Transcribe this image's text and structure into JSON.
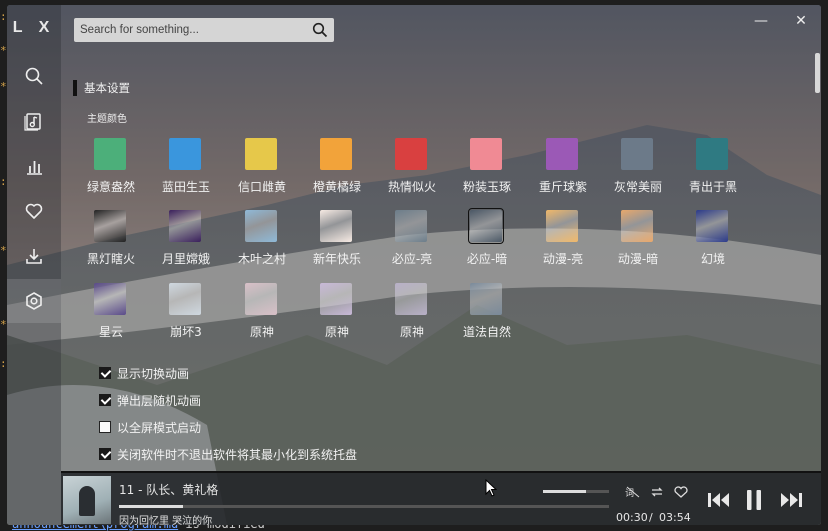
{
  "app": {
    "logo": "L X"
  },
  "search": {
    "placeholder": "Search for something..."
  },
  "window_controls": {
    "minimize": "—",
    "close": "✕"
  },
  "sidebar": {
    "items": [
      {
        "name": "search",
        "icon": "search-icon"
      },
      {
        "name": "songlist",
        "icon": "playlist-icon"
      },
      {
        "name": "leaderboard",
        "icon": "chart-icon"
      },
      {
        "name": "my-list",
        "icon": "heart-icon"
      },
      {
        "name": "download",
        "icon": "download-icon"
      },
      {
        "name": "settings",
        "icon": "settings-icon",
        "active": true
      }
    ]
  },
  "settings": {
    "section_title": "基本设置",
    "theme_label": "主题颜色",
    "themes": [
      {
        "label": "绿意盎然",
        "color": "#4caf7a",
        "type": "color"
      },
      {
        "label": "蓝田生玉",
        "color": "#3a96dd",
        "type": "color"
      },
      {
        "label": "信口雌黄",
        "color": "#e6c84a",
        "type": "color"
      },
      {
        "label": "橙黄橘绿",
        "color": "#f2a33a",
        "type": "color"
      },
      {
        "label": "热情似火",
        "color": "#d94040",
        "type": "color"
      },
      {
        "label": "粉装玉琢",
        "color": "#f08a94",
        "type": "color"
      },
      {
        "label": "重斤球紫",
        "color": "#9b59b6",
        "type": "color"
      },
      {
        "label": "灰常美丽",
        "color": "#6c7a89",
        "type": "color"
      },
      {
        "label": "青出于黑",
        "color": "#2f7a82",
        "type": "color"
      },
      {
        "label": "黑灯瞎火",
        "color": "#222222",
        "type": "image"
      },
      {
        "label": "月里嫦娥",
        "color": "#3a1f5c",
        "type": "image"
      },
      {
        "label": "木叶之村",
        "color": "#8fb9d8",
        "type": "image"
      },
      {
        "label": "新年快乐",
        "color": "#f7ebe4",
        "type": "image"
      },
      {
        "label": "必应-亮",
        "color": "#6c7d8a",
        "type": "image"
      },
      {
        "label": "必应-暗",
        "color": "#4b5866",
        "type": "image",
        "selected": true
      },
      {
        "label": "动漫-亮",
        "color": "#f0b86a",
        "type": "image"
      },
      {
        "label": "动漫-暗",
        "color": "#e8a86c",
        "type": "image"
      },
      {
        "label": "幻境",
        "color": "#2b3a8a",
        "type": "image"
      },
      {
        "label": "星云",
        "color": "#5a4a8a",
        "type": "image"
      },
      {
        "label": "崩坏3",
        "color": "#cfd8e0",
        "type": "image"
      },
      {
        "label": "原神",
        "color": "#d9c0c8",
        "type": "image"
      },
      {
        "label": "原神",
        "color": "#c8b8d8",
        "type": "image"
      },
      {
        "label": "原神",
        "color": "#b8b0c8",
        "type": "image"
      },
      {
        "label": "道法自然",
        "color": "#7a8a9a",
        "type": "image"
      }
    ],
    "options": [
      {
        "label": "显示切换动画",
        "checked": true
      },
      {
        "label": "弹出层随机动画",
        "checked": true
      },
      {
        "label": "以全屏模式启动",
        "checked": false
      },
      {
        "label": "关闭软件时不退出软件将其最小化到系统托盘",
        "checked": true
      }
    ]
  },
  "player": {
    "title": "11 - 队长、黄礼格",
    "lyric": "因为回忆里 哭泣的你",
    "current_time": "00:30",
    "separator": "/",
    "total_time": "03:54",
    "progress_fraction": 0.13,
    "volume_fraction": 0.65
  },
  "desktop": {
    "terminal_line": "announcement\\program.md is modified",
    "terminal_link": "announcement\\program.md"
  }
}
